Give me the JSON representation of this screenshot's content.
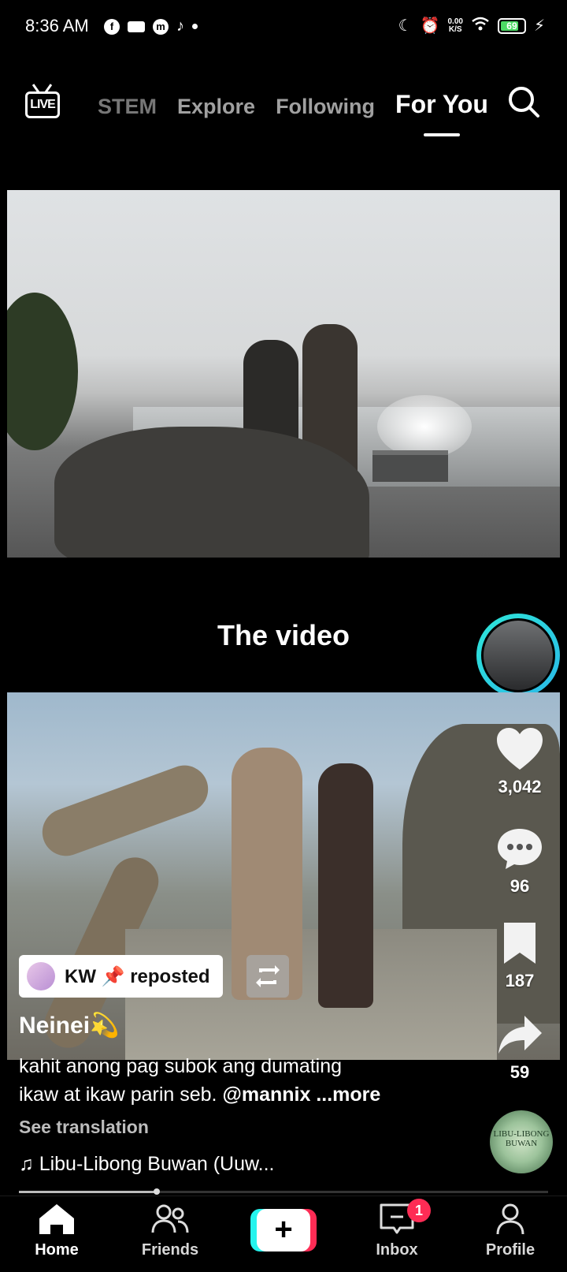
{
  "status_bar": {
    "time": "8:36 AM",
    "net_speed_value": "0.00",
    "net_speed_unit": "K/S",
    "battery": "69"
  },
  "top_nav": {
    "live_label": "LIVE",
    "tabs": [
      "STEM",
      "Explore",
      "Following",
      "For You"
    ],
    "active_tab": "For You"
  },
  "post": {
    "overlay_title": "The video",
    "likes": "3,042",
    "comments": "96",
    "bookmarks": "187",
    "shares": "59",
    "repost_label": "KW 📌 reposted",
    "author": "Neinei💫",
    "description_line1": "kahit anong pag subok ang dumating",
    "description_line2": "ikaw at ikaw parin seb.",
    "mention": "@mannix",
    "more_label": "...more",
    "see_translation": "See translation",
    "music": "♫ Libu-Libong Buwan (Uuw...",
    "disc_text": "LIBU-LIBONG BUWAN",
    "playback_progress": 0.26
  },
  "bottom_nav": {
    "home": "Home",
    "friends": "Friends",
    "add_symbol": "+",
    "inbox": "Inbox",
    "inbox_badge": "1",
    "profile": "Profile"
  }
}
